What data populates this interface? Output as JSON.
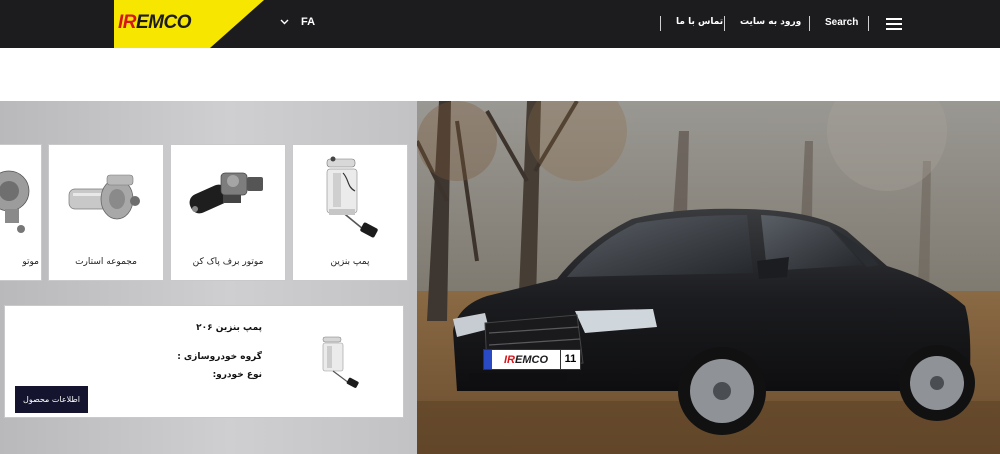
{
  "header": {
    "logo": {
      "prefix": "IR",
      "suffix": "EMCO"
    },
    "language": "FA",
    "nav": {
      "contact": "تماس با ما",
      "login": "ورود به سایت",
      "search": "Search"
    },
    "icons": {
      "language_caret": "chevron-down-icon",
      "menu": "hamburger-menu-icon"
    },
    "colors": {
      "bar": "#1c1c1f",
      "logo_block": "#f7e600",
      "logo_accent": "#d7141a"
    }
  },
  "products": [
    {
      "label": "پمپ بنزین",
      "icon": "fuel-pump-image"
    },
    {
      "label": "موتور برف پاک کن",
      "icon": "wiper-motor-image"
    },
    {
      "label": "مجموعه استارت",
      "icon": "starter-motor-image"
    },
    {
      "label": "موتو",
      "icon": "motor-image"
    }
  ],
  "detail": {
    "title": "پمپ بنزین ۲۰۶",
    "group_label": "گروه خودروسازی :",
    "type_label": "نوع خودرو:",
    "button": "اطلاعات محصول",
    "colors": {
      "button": "#14142e"
    }
  },
  "hero": {
    "plate_brand": {
      "prefix": "IR",
      "suffix": "EMCO"
    },
    "plate_number": "11"
  }
}
